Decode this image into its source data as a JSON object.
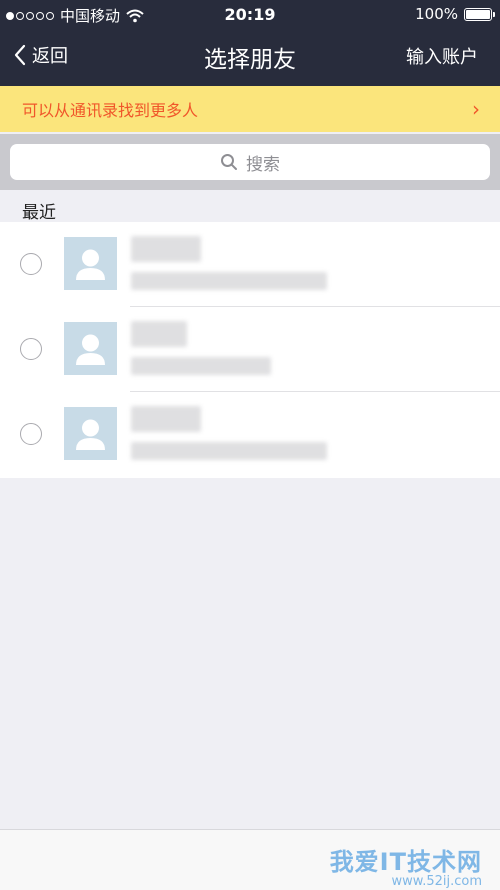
{
  "status_bar": {
    "carrier": "中国移动",
    "time": "20:19",
    "battery": "100%",
    "signal_bars_filled": 1,
    "signal_bars_total": 5
  },
  "nav": {
    "back_label": "返回",
    "title": "选择朋友",
    "right_action": "输入账户"
  },
  "banner": {
    "text": "可以从通讯录找到更多人",
    "chevron": "›"
  },
  "search": {
    "placeholder": "搜索"
  },
  "section": {
    "title": "最近"
  },
  "contacts": [
    {
      "avatar_icon": "person-placeholder-icon",
      "name_hidden": true,
      "detail_hidden": true
    },
    {
      "avatar_icon": "person-placeholder-icon",
      "name_hidden": true,
      "detail_hidden": true
    },
    {
      "avatar_icon": "person-placeholder-icon",
      "name_hidden": true,
      "detail_hidden": true
    }
  ],
  "watermark": {
    "main": "我爱IT技术网",
    "sub": "www.52ij.com"
  },
  "colors": {
    "nav_bg": "#282c3c",
    "banner_bg": "#fbe57c",
    "banner_text": "#f0562a",
    "page_bg": "#efeff4",
    "avatar_bg": "#c8dbe7"
  }
}
